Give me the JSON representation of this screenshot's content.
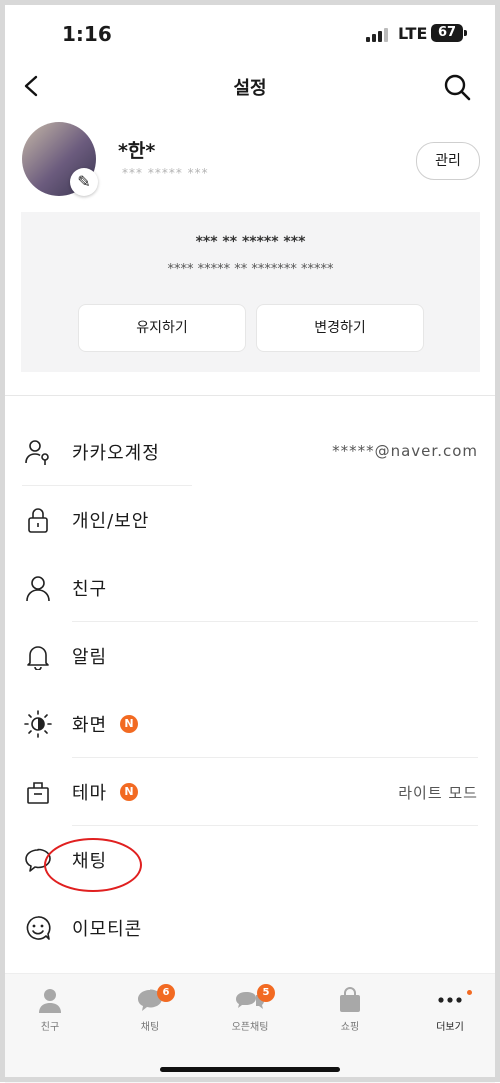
{
  "status_bar": {
    "time": "1:16",
    "network": "LTE",
    "battery": "67"
  },
  "header": {
    "title": "설정"
  },
  "profile": {
    "name": "*한*",
    "email": "*** ***** ***",
    "manage_label": "관리"
  },
  "notice": {
    "line1": "*** ** ***** ***",
    "line2": "**** ***** ** ******* *****",
    "keep_label": "유지하기",
    "change_label": "변경하기"
  },
  "menu": [
    {
      "label": "카카오계정",
      "right": "*****@naver.com",
      "icon": "person-key-icon"
    },
    {
      "label": "개인/보안",
      "icon": "lock-icon"
    },
    {
      "label": "친구",
      "icon": "person-icon"
    },
    {
      "label": "알림",
      "icon": "bell-icon"
    },
    {
      "label": "화면",
      "badge": "N",
      "icon": "brightness-icon"
    },
    {
      "label": "테마",
      "badge": "N",
      "right": "라이트 모드",
      "icon": "theme-icon"
    },
    {
      "label": "채팅",
      "icon": "chat-bubble-icon"
    },
    {
      "label": "이모티콘",
      "icon": "emoticon-icon"
    }
  ],
  "tabs": [
    {
      "label": "친구",
      "icon": "friends-icon"
    },
    {
      "label": "채팅",
      "badge": "6",
      "icon": "chat-icon"
    },
    {
      "label": "오픈채팅",
      "badge": "5",
      "icon": "open-chat-icon"
    },
    {
      "label": "쇼핑",
      "icon": "shopping-icon"
    },
    {
      "label": "더보기",
      "icon": "more-icon"
    }
  ],
  "colors": {
    "accent": "#f26a22",
    "highlight_circle": "#e02020"
  }
}
